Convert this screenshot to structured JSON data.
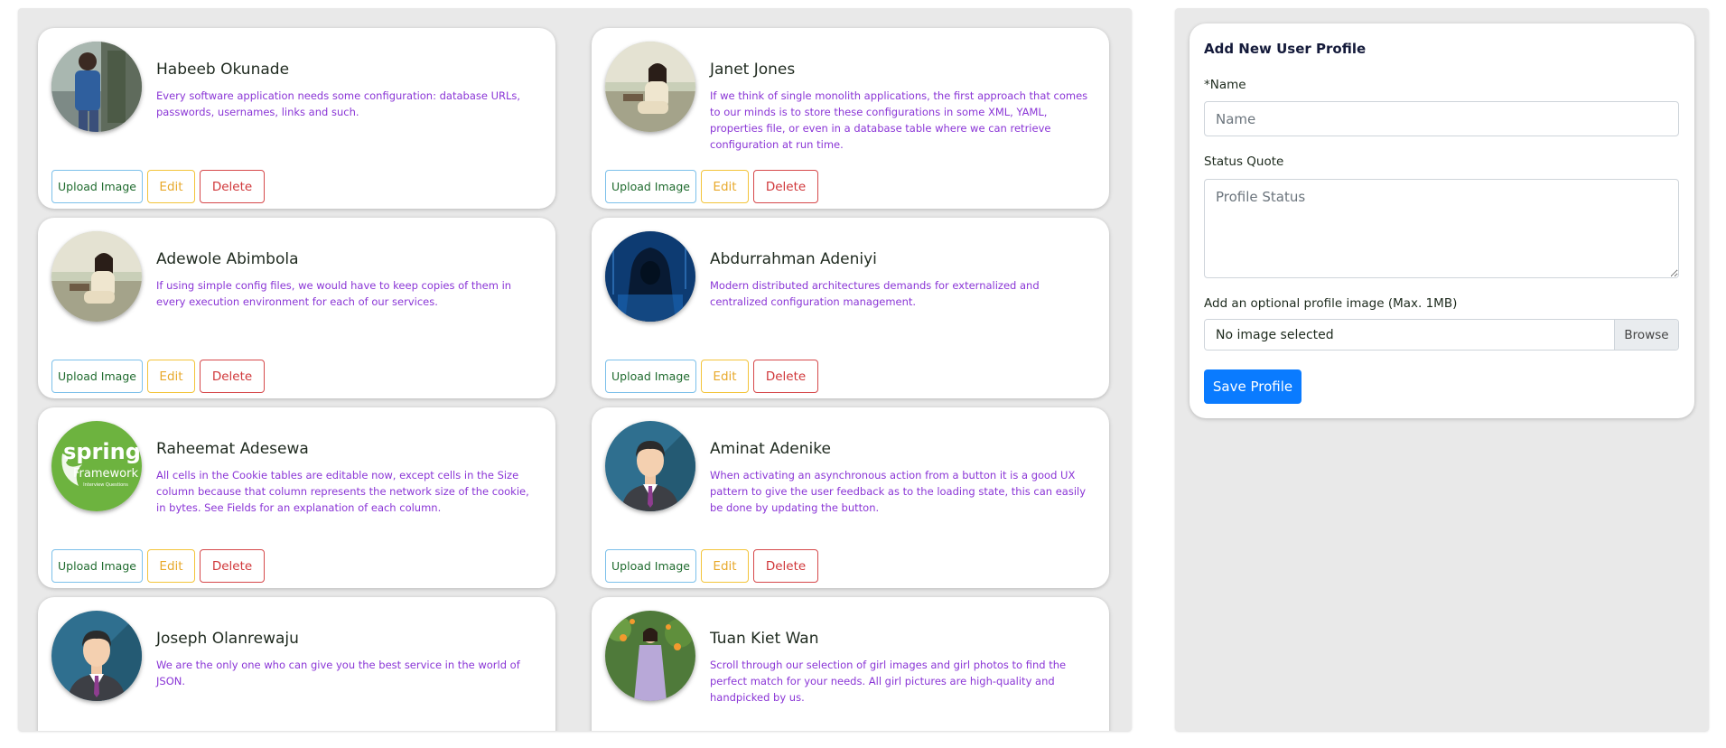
{
  "profiles": [
    {
      "name": "Habeeb Okunade",
      "quote": "Every software application needs some configuration: database URLs, passwords, usernames, links and such.",
      "avatar": "man-in-blue-shirt-photo"
    },
    {
      "name": "Janet Jones",
      "quote": "If we think of single monolith applications, the first approach that comes to our minds is to store these configurations in some XML, YAML, properties file, or even in a database table where we can retrieve configuration at run time.",
      "avatar": "woman-sitting-photo"
    },
    {
      "name": "Adewole Abimbola",
      "quote": "If using simple config files, we would have to keep copies of them in every execution environment for each of our services.",
      "avatar": "woman-sitting-photo"
    },
    {
      "name": "Abdurrahman Adeniyi",
      "quote": "Modern distributed architectures demands for externalized and centralized configuration management.",
      "avatar": "hooded-hacker-image"
    },
    {
      "name": "Raheemat Adesewa",
      "quote": "All cells in the Cookie tables are editable now, except cells in the Size column because that column represents the network size of the cookie, in bytes. See Fields for an explanation of each column.",
      "avatar": "spring-framework-logo"
    },
    {
      "name": "Aminat Adenike",
      "quote": "When activating an asynchronous action from a button it is a good UX pattern to give the user feedback as to the loading state, this can easily be done by updating the button.",
      "avatar": "businessman-avatar"
    },
    {
      "name": "Joseph Olanrewaju",
      "quote": "We are the only one who can give you the best service in the world of JSON.",
      "avatar": "businessman-avatar"
    },
    {
      "name": "Tuan Kiet Wan",
      "quote": "Scroll through our selection of girl images and girl photos to find the perfect match for your needs. All girl pictures are high-quality and handpicked by us.",
      "avatar": "woman-in-garden-photo"
    }
  ],
  "buttons": {
    "upload": "Upload Image",
    "edit": "Edit",
    "delete": "Delete"
  },
  "logo": {
    "line1": "spring",
    "line2": "Framework",
    "line3": "Interview Questions"
  },
  "form": {
    "title": "Add New User Profile",
    "name_label": "*Name",
    "name_placeholder": "Name",
    "status_label": "Status Quote",
    "status_placeholder": "Profile Status",
    "image_label": "Add an optional profile image (Max. 1MB)",
    "file_status": "No image selected",
    "browse_label": "Browse",
    "save_label": "Save Profile"
  },
  "colors": {
    "name_text": "#1f2a1f",
    "quote_text": "#8a35d6",
    "upload_border": "#7cc0ea",
    "edit_color": "#e8a92b",
    "delete_color": "#d0373a",
    "save_button": "#0a7bff",
    "panel_bg": "#e9e9e9"
  }
}
